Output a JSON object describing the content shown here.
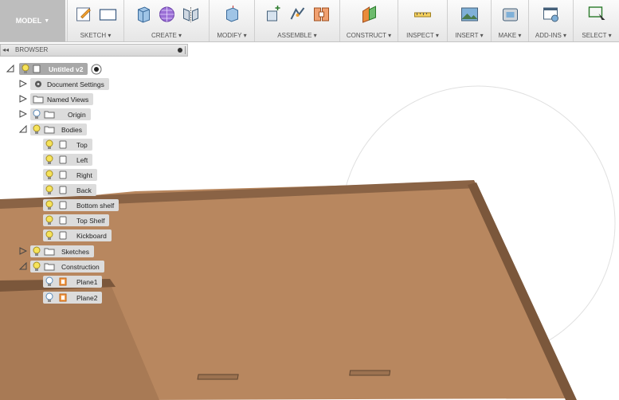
{
  "toolbar": {
    "workspace": "MODEL",
    "groups": [
      "SKETCH",
      "CREATE",
      "MODIFY",
      "ASSEMBLE",
      "CONSTRUCT",
      "INSPECT",
      "INSERT",
      "MAKE",
      "ADD-INS",
      "SELECT"
    ]
  },
  "browser": {
    "title": "BROWSER",
    "root": "Untitled v2",
    "nodes": [
      {
        "label": "Document Settings"
      },
      {
        "label": "Named Views"
      },
      {
        "label": "Origin"
      },
      {
        "label": "Bodies"
      },
      {
        "label": "Top"
      },
      {
        "label": "Left"
      },
      {
        "label": "Right"
      },
      {
        "label": "Back"
      },
      {
        "label": "Bottom shelf"
      },
      {
        "label": "Top Shelf"
      },
      {
        "label": "Kickboard"
      },
      {
        "label": "Sketches"
      },
      {
        "label": "Construction"
      },
      {
        "label": "Plane1"
      },
      {
        "label": "Plane2"
      }
    ]
  },
  "colors": {
    "board": "#b8875f",
    "accent": "#3a8ec6"
  }
}
